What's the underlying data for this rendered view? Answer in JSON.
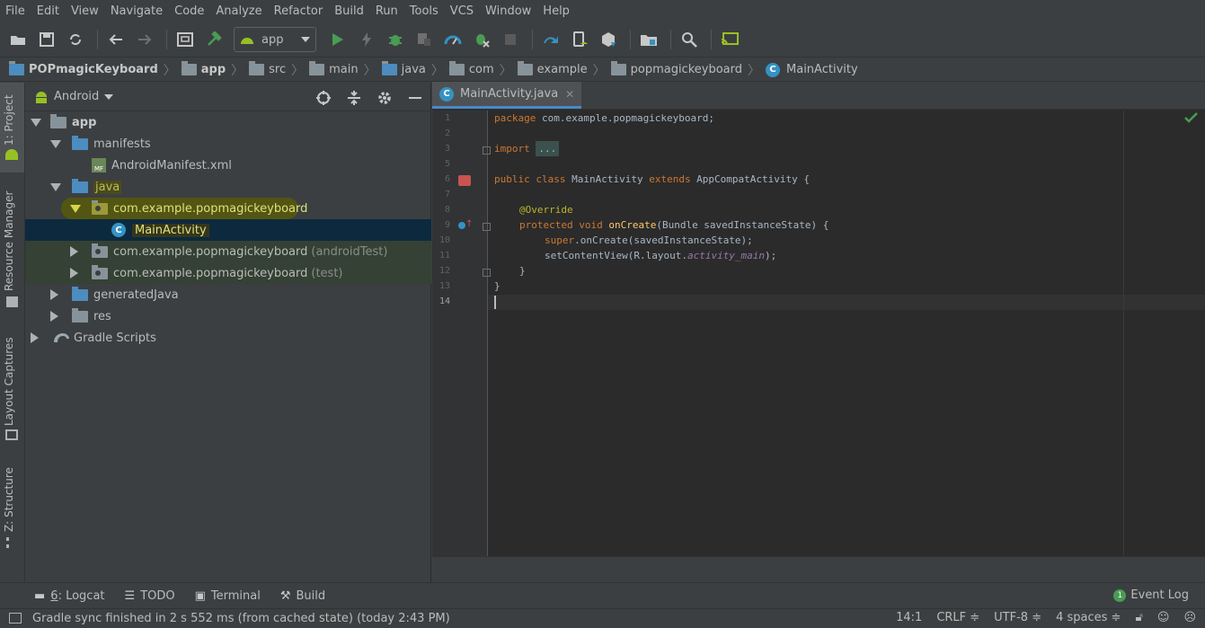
{
  "menu": [
    "File",
    "Edit",
    "View",
    "Navigate",
    "Code",
    "Analyze",
    "Refactor",
    "Build",
    "Run",
    "Tools",
    "VCS",
    "Window",
    "Help"
  ],
  "toolbar": {
    "config": "app",
    "icons": [
      "open-icon",
      "save-icon",
      "sync-icon",
      "back-icon",
      "forward-icon",
      "device-window-icon",
      "make-hammer-icon",
      "run-icon",
      "apply-changes-icon",
      "debug-icon",
      "attach-icon",
      "profile-icon",
      "coverage-icon",
      "stop-icon",
      "gradle-sync-icon",
      "avd-manager-icon",
      "sdk-manager-icon",
      "project-structure-icon",
      "search-icon",
      "cast-icon"
    ]
  },
  "breadcrumb": [
    "POPmagicKeyboard",
    "app",
    "src",
    "main",
    "java",
    "com",
    "example",
    "popmagickeyboard",
    "MainActivity"
  ],
  "left_tabs": [
    "1: Project",
    "Resource Manager",
    "Layout Captures",
    "Z: Structure"
  ],
  "project": {
    "view": "Android",
    "tree": [
      {
        "label": "app",
        "level": 0,
        "expanded": true,
        "bold": true
      },
      {
        "label": "manifests",
        "level": 1,
        "expanded": true
      },
      {
        "label": "AndroidManifest.xml",
        "level": 2
      },
      {
        "label": "java",
        "level": 1,
        "expanded": true
      },
      {
        "label": "com.example.popmagickeyboard",
        "level": 2,
        "expanded": true
      },
      {
        "label": "MainActivity",
        "level": 3,
        "selected": true
      },
      {
        "label": "com.example.popmagickeyboard",
        "suffix": "(androidTest)",
        "level": 2
      },
      {
        "label": "com.example.popmagickeyboard",
        "suffix": "(test)",
        "level": 2
      },
      {
        "label": "generatedJava",
        "level": 1
      },
      {
        "label": "res",
        "level": 1
      },
      {
        "label": "Gradle Scripts",
        "level": 0
      }
    ]
  },
  "editor": {
    "tab": "MainActivity.java",
    "line_numbers": [
      "1",
      "2",
      "3",
      "5",
      "6",
      "7",
      "8",
      "9",
      "10",
      "11",
      "12",
      "13",
      "14"
    ],
    "code": {
      "l1_kw": "package",
      "l1_rest": " com.example.popmagickeyboard;",
      "l3_kw": "import",
      "l3_fold": "...",
      "l6_kw": "public class",
      "l6_name": " MainActivity ",
      "l6_kw2": "extends",
      "l6_rest": " AppCompatActivity {",
      "l8_ann": "@Override",
      "l9_kw": "protected void",
      "l9_fn": "onCreate",
      "l9_rest": "(Bundle savedInstanceState) {",
      "l10_kw": "super",
      "l10_rest": ".onCreate(savedInstanceState);",
      "l11_pre": "setContentView(R.layout.",
      "l11_it": "activity_main",
      "l11_post": ");",
      "l12": "}",
      "l13": "}"
    }
  },
  "bottom_tools": [
    {
      "key": "6",
      "label": ": Logcat"
    },
    {
      "key": "",
      "label": "TODO"
    },
    {
      "key": "",
      "label": "Terminal"
    },
    {
      "key": "",
      "label": "Build"
    }
  ],
  "event_log": {
    "count": "1",
    "label": "Event Log"
  },
  "status": {
    "message": "Gradle sync finished in 2 s 552 ms (from cached state) (today 2:43 PM)",
    "position": "14:1",
    "line_sep": "CRLF ≑",
    "encoding": "UTF-8 ≑",
    "indent": "4 spaces ≑"
  }
}
